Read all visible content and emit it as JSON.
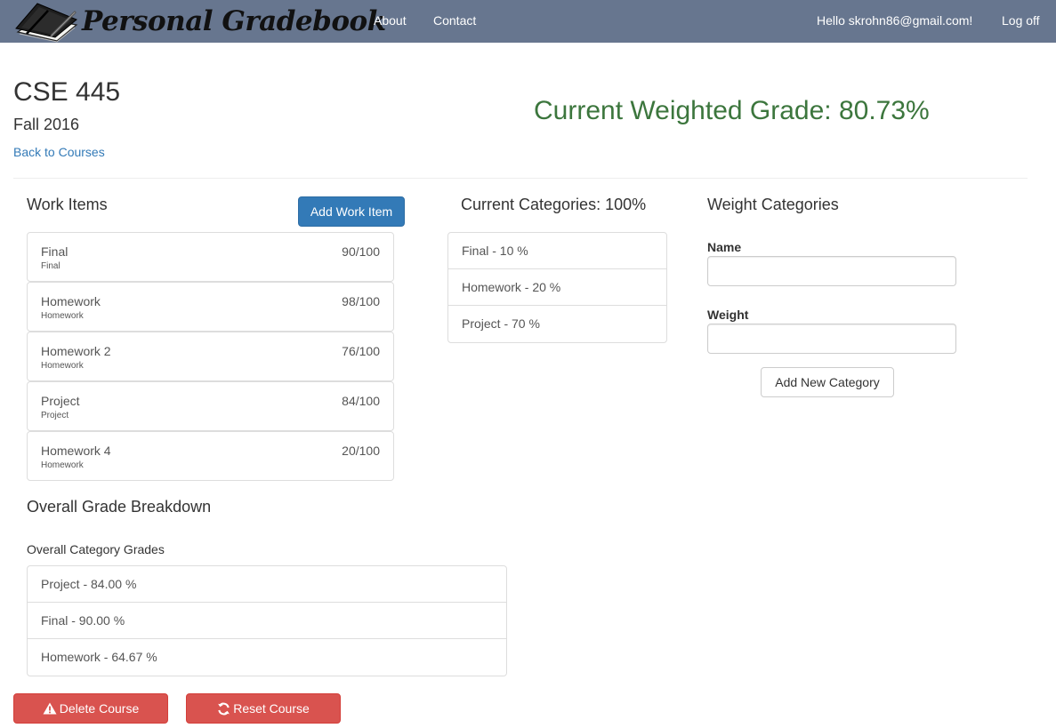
{
  "nav": {
    "brand": "Personal Gradebook",
    "about": "About",
    "contact": "Contact",
    "greeting": "Hello skrohn86@gmail.com!",
    "logoff": "Log off"
  },
  "course": {
    "title": "CSE 445",
    "term": "Fall 2016",
    "back_link": "Back to Courses",
    "weighted_grade": "Current Weighted Grade: 80.73%"
  },
  "work_items": {
    "heading": "Work Items",
    "add_button": "Add Work Item",
    "items": [
      {
        "name": "Final",
        "category": "Final",
        "score": "90/100"
      },
      {
        "name": "Homework",
        "category": "Homework",
        "score": "98/100"
      },
      {
        "name": "Homework 2",
        "category": "Homework",
        "score": "76/100"
      },
      {
        "name": "Project",
        "category": "Project",
        "score": "84/100"
      },
      {
        "name": "Homework 4",
        "category": "Homework",
        "score": "20/100"
      }
    ]
  },
  "current_categories": {
    "heading": "Current Categories: 100%",
    "items": [
      "Final - 10 %",
      "Homework - 20 %",
      "Project - 70 %"
    ]
  },
  "weight_categories": {
    "heading": "Weight Categories",
    "name_label": "Name",
    "name_value": "",
    "weight_label": "Weight",
    "weight_value": "",
    "add_button": "Add New Category"
  },
  "breakdown": {
    "heading": "Overall Grade Breakdown",
    "subheading": "Overall Category Grades",
    "items": [
      "Project - 84.00 %",
      "Final - 90.00 %",
      "Homework - 64.67 %"
    ]
  },
  "actions": {
    "delete": "Delete Course",
    "reset": "Reset Course"
  },
  "colors": {
    "navbar": "#67768f",
    "link": "#337ab7",
    "success_text": "#3c763d",
    "primary": "#337ab7",
    "danger": "#d9534f"
  },
  "icons": {
    "brand": "notebook-icon",
    "delete": "warning-triangle-icon",
    "reset": "refresh-icon"
  }
}
